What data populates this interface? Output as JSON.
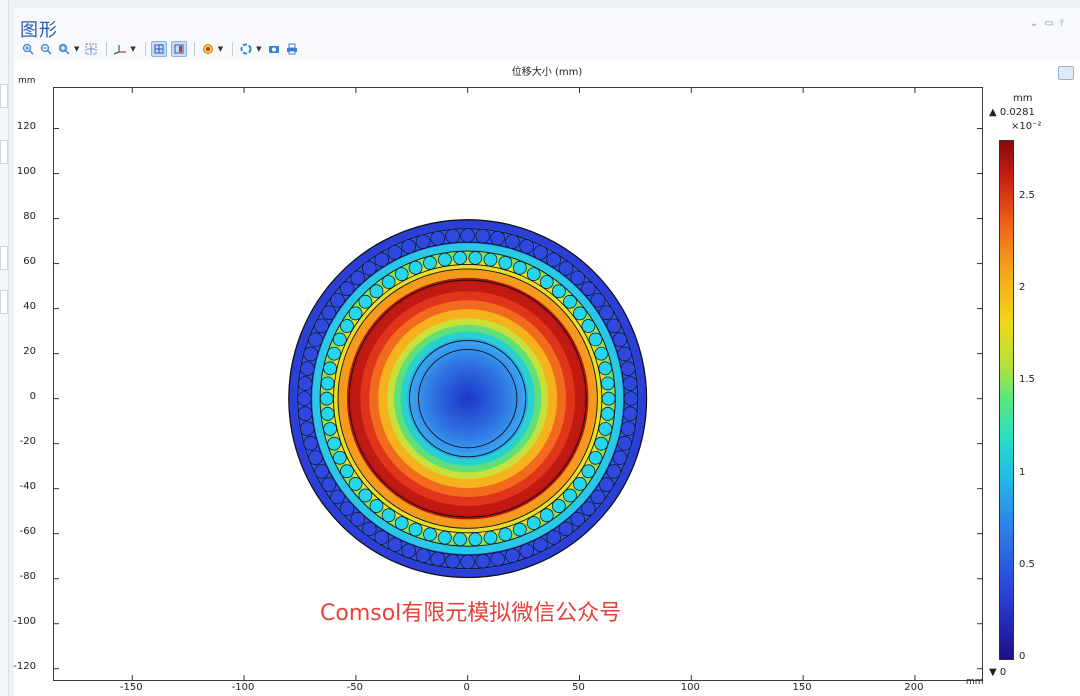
{
  "window": {
    "title": "图形",
    "controls": [
      "collapse",
      "maximize",
      "pin"
    ],
    "toolbar_icons": [
      "zoom-in-icon",
      "zoom-out-icon",
      "zoom-box-icon",
      "zoom-extents-icon",
      "axis-orientation-icon",
      "grid-icon",
      "pane-icon",
      "scene-light-icon",
      "transparency-icon",
      "camera-icon",
      "print-icon"
    ]
  },
  "plot": {
    "title": "位移大小 (mm)",
    "y_unit": "mm",
    "x_unit": "mm",
    "watermark": "Comsol有限元模拟微信公众号"
  },
  "colorbar": {
    "unit": "mm",
    "max_label": "▲ 0.0281",
    "exponent": "×10⁻²",
    "ticks": [
      "2.5",
      "2",
      "1.5",
      "1",
      "0.5",
      "0"
    ],
    "min_label": "▼ 0",
    "colors": {
      "low": "#1b0f88",
      "mid": "#55e87d",
      "high": "#8a0a0a"
    }
  },
  "chart_data": {
    "type": "heatmap",
    "title": "位移大小 (mm)",
    "xlabel": "mm",
    "ylabel": "mm",
    "xlim": [
      -185,
      230
    ],
    "ylim": [
      -125,
      138
    ],
    "x_ticks": [
      "-150",
      "-100",
      "-50",
      "0",
      "50",
      "100",
      "150",
      "200"
    ],
    "y_ticks": [
      "120",
      "100",
      "80",
      "60",
      "40",
      "20",
      "0",
      "-20",
      "-40",
      "-60",
      "-80",
      "-100",
      "-120"
    ],
    "color_range": [
      0,
      0.0281
    ],
    "geometry_radii_mm": [
      80,
      76,
      70,
      66,
      60,
      58,
      53,
      26,
      22
    ],
    "rings_of_circles": [
      {
        "radius_mm": 73,
        "count": 68,
        "circle_radius_mm": 3.1,
        "value_mm": 0.0035
      },
      {
        "radius_mm": 63,
        "count": 58,
        "circle_radius_mm": 2.9,
        "value_mm": 0.0105
      }
    ]
  }
}
